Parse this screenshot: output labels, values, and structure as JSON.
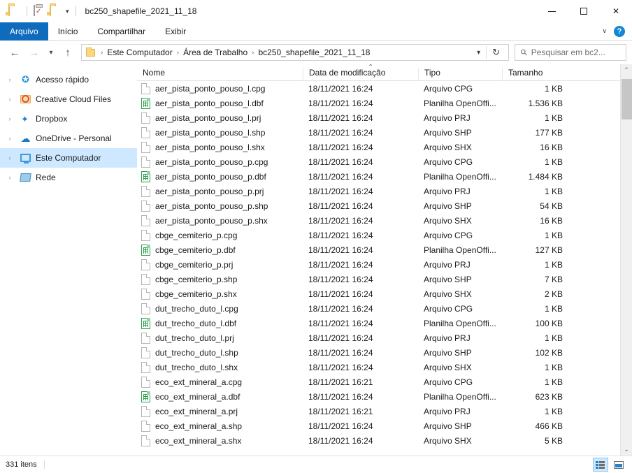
{
  "window": {
    "title": "bc250_shapefile_2021_11_18",
    "quick_access": [
      {
        "name": "folder-icon",
        "label": "Pasta"
      },
      {
        "name": "properties-icon",
        "label": "Propriedades"
      },
      {
        "name": "new-folder-icon",
        "label": "Nova pasta"
      }
    ],
    "controls": {
      "minimize": "–",
      "maximize": "☐",
      "close": "✕"
    }
  },
  "ribbon": {
    "tabs": [
      {
        "label": "Arquivo",
        "selected": true
      },
      {
        "label": "Início",
        "selected": false
      },
      {
        "label": "Compartilhar",
        "selected": false
      },
      {
        "label": "Exibir",
        "selected": false
      }
    ],
    "expand_label": "∨",
    "help_label": "?"
  },
  "address": {
    "back": "←",
    "forward": "→",
    "recent": "∨",
    "up": "↑",
    "breadcrumbs": [
      "Este Computador",
      "Área de Trabalho",
      "bc250_shapefile_2021_11_18"
    ],
    "separator": "›",
    "dropdown": "∨",
    "refresh": "↻"
  },
  "search": {
    "placeholder": "Pesquisar em bc2...",
    "icon": "search-icon"
  },
  "sidebar": {
    "items": [
      {
        "label": "Acesso rápido",
        "icon": "star-icon",
        "selected": false
      },
      {
        "label": "Creative Cloud Files",
        "icon": "creative-cloud-folder-icon",
        "selected": false
      },
      {
        "label": "Dropbox",
        "icon": "dropbox-icon",
        "selected": false
      },
      {
        "label": "OneDrive - Personal",
        "icon": "onedrive-cloud-icon",
        "selected": false
      },
      {
        "label": "Este Computador",
        "icon": "computer-monitor-icon",
        "selected": true
      },
      {
        "label": "Rede",
        "icon": "network-icon",
        "selected": false
      }
    ],
    "expand_chevron": "›"
  },
  "columns": {
    "name": "Nome",
    "date": "Data de modificação",
    "type": "Tipo",
    "size": "Tamanho",
    "sort_caret": "⌃"
  },
  "files": [
    {
      "name": "aer_pista_ponto_pouso_l.cpg",
      "date": "18/11/2021 16:24",
      "type": "Arquivo CPG",
      "size": "1 KB",
      "icon": "generic-file-icon"
    },
    {
      "name": "aer_pista_ponto_pouso_l.dbf",
      "date": "18/11/2021 16:24",
      "type": "Planilha OpenOffi...",
      "size": "1.536 KB",
      "icon": "spreadsheet-file-icon"
    },
    {
      "name": "aer_pista_ponto_pouso_l.prj",
      "date": "18/11/2021 16:24",
      "type": "Arquivo PRJ",
      "size": "1 KB",
      "icon": "generic-file-icon"
    },
    {
      "name": "aer_pista_ponto_pouso_l.shp",
      "date": "18/11/2021 16:24",
      "type": "Arquivo SHP",
      "size": "177 KB",
      "icon": "generic-file-icon"
    },
    {
      "name": "aer_pista_ponto_pouso_l.shx",
      "date": "18/11/2021 16:24",
      "type": "Arquivo SHX",
      "size": "16 KB",
      "icon": "generic-file-icon"
    },
    {
      "name": "aer_pista_ponto_pouso_p.cpg",
      "date": "18/11/2021 16:24",
      "type": "Arquivo CPG",
      "size": "1 KB",
      "icon": "generic-file-icon"
    },
    {
      "name": "aer_pista_ponto_pouso_p.dbf",
      "date": "18/11/2021 16:24",
      "type": "Planilha OpenOffi...",
      "size": "1.484 KB",
      "icon": "spreadsheet-file-icon"
    },
    {
      "name": "aer_pista_ponto_pouso_p.prj",
      "date": "18/11/2021 16:24",
      "type": "Arquivo PRJ",
      "size": "1 KB",
      "icon": "generic-file-icon"
    },
    {
      "name": "aer_pista_ponto_pouso_p.shp",
      "date": "18/11/2021 16:24",
      "type": "Arquivo SHP",
      "size": "54 KB",
      "icon": "generic-file-icon"
    },
    {
      "name": "aer_pista_ponto_pouso_p.shx",
      "date": "18/11/2021 16:24",
      "type": "Arquivo SHX",
      "size": "16 KB",
      "icon": "generic-file-icon"
    },
    {
      "name": "cbge_cemiterio_p.cpg",
      "date": "18/11/2021 16:24",
      "type": "Arquivo CPG",
      "size": "1 KB",
      "icon": "generic-file-icon"
    },
    {
      "name": "cbge_cemiterio_p.dbf",
      "date": "18/11/2021 16:24",
      "type": "Planilha OpenOffi...",
      "size": "127 KB",
      "icon": "spreadsheet-file-icon"
    },
    {
      "name": "cbge_cemiterio_p.prj",
      "date": "18/11/2021 16:24",
      "type": "Arquivo PRJ",
      "size": "1 KB",
      "icon": "generic-file-icon"
    },
    {
      "name": "cbge_cemiterio_p.shp",
      "date": "18/11/2021 16:24",
      "type": "Arquivo SHP",
      "size": "7 KB",
      "icon": "generic-file-icon"
    },
    {
      "name": "cbge_cemiterio_p.shx",
      "date": "18/11/2021 16:24",
      "type": "Arquivo SHX",
      "size": "2 KB",
      "icon": "generic-file-icon"
    },
    {
      "name": "dut_trecho_duto_l.cpg",
      "date": "18/11/2021 16:24",
      "type": "Arquivo CPG",
      "size": "1 KB",
      "icon": "generic-file-icon"
    },
    {
      "name": "dut_trecho_duto_l.dbf",
      "date": "18/11/2021 16:24",
      "type": "Planilha OpenOffi...",
      "size": "100 KB",
      "icon": "spreadsheet-file-icon"
    },
    {
      "name": "dut_trecho_duto_l.prj",
      "date": "18/11/2021 16:24",
      "type": "Arquivo PRJ",
      "size": "1 KB",
      "icon": "generic-file-icon"
    },
    {
      "name": "dut_trecho_duto_l.shp",
      "date": "18/11/2021 16:24",
      "type": "Arquivo SHP",
      "size": "102 KB",
      "icon": "generic-file-icon"
    },
    {
      "name": "dut_trecho_duto_l.shx",
      "date": "18/11/2021 16:24",
      "type": "Arquivo SHX",
      "size": "1 KB",
      "icon": "generic-file-icon"
    },
    {
      "name": "eco_ext_mineral_a.cpg",
      "date": "18/11/2021 16:21",
      "type": "Arquivo CPG",
      "size": "1 KB",
      "icon": "generic-file-icon"
    },
    {
      "name": "eco_ext_mineral_a.dbf",
      "date": "18/11/2021 16:24",
      "type": "Planilha OpenOffi...",
      "size": "623 KB",
      "icon": "spreadsheet-file-icon"
    },
    {
      "name": "eco_ext_mineral_a.prj",
      "date": "18/11/2021 16:21",
      "type": "Arquivo PRJ",
      "size": "1 KB",
      "icon": "generic-file-icon"
    },
    {
      "name": "eco_ext_mineral_a.shp",
      "date": "18/11/2021 16:24",
      "type": "Arquivo SHP",
      "size": "466 KB",
      "icon": "generic-file-icon"
    },
    {
      "name": "eco_ext_mineral_a.shx",
      "date": "18/11/2021 16:24",
      "type": "Arquivo SHX",
      "size": "5 KB",
      "icon": "generic-file-icon"
    }
  ],
  "statusbar": {
    "item_count": "331 itens",
    "views": [
      {
        "name": "details-view",
        "active": true
      },
      {
        "name": "large-icons-view",
        "active": false
      }
    ]
  },
  "scrollbar": {
    "up": "⌃",
    "down": "⌄"
  },
  "colors": {
    "accent": "#0f6cbd",
    "selection": "#cde8ff",
    "folder": "#fcd77f",
    "sheet_green": "#2f9e4f"
  }
}
